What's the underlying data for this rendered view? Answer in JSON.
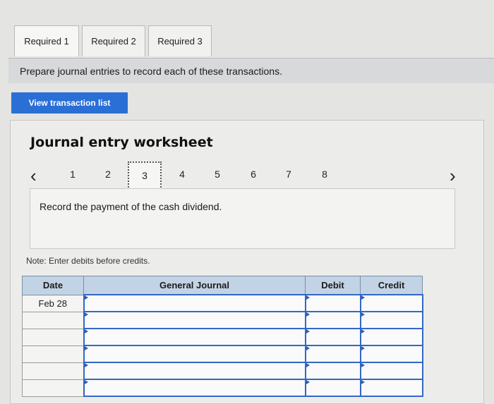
{
  "tabs": [
    {
      "label": "Required 1",
      "active": true
    },
    {
      "label": "Required 2",
      "active": false
    },
    {
      "label": "Required 3",
      "active": false
    }
  ],
  "instruction": "Prepare journal entries to record each of these transactions.",
  "view_button": "View transaction list",
  "worksheet": {
    "title": "Journal entry worksheet",
    "pager": {
      "prev_icon": "chevron-left-icon",
      "next_icon": "chevron-right-icon",
      "pages": [
        "1",
        "2",
        "3",
        "4",
        "5",
        "6",
        "7",
        "8"
      ],
      "active_page": "3"
    },
    "prompt": "Record the payment of the cash dividend.",
    "note": "Note: Enter debits before credits.",
    "table": {
      "headers": {
        "date": "Date",
        "journal": "General Journal",
        "debit": "Debit",
        "credit": "Credit"
      },
      "rows": [
        {
          "date": "Feb 28",
          "account": "",
          "debit": "",
          "credit": ""
        },
        {
          "date": "",
          "account": "",
          "debit": "",
          "credit": ""
        },
        {
          "date": "",
          "account": "",
          "debit": "",
          "credit": ""
        },
        {
          "date": "",
          "account": "",
          "debit": "",
          "credit": ""
        },
        {
          "date": "",
          "account": "",
          "debit": "",
          "credit": ""
        },
        {
          "date": "",
          "account": "",
          "debit": "",
          "credit": ""
        }
      ]
    }
  },
  "colors": {
    "accent": "#2a6fd6",
    "table_header": "#c3d3e6",
    "input_border": "#3367c6"
  }
}
